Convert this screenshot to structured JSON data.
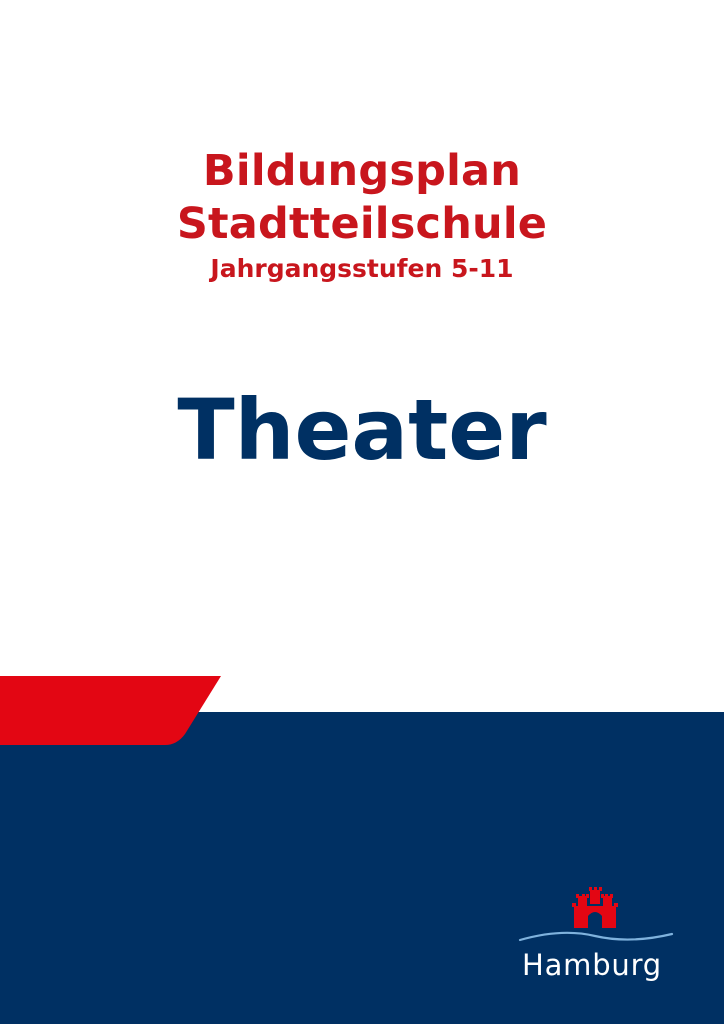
{
  "document": {
    "title_line_1": "Bildungsplan",
    "title_line_2": "Stadtteilschule",
    "subtitle": "Jahrgangsstufen 5-11",
    "subject": "Theater"
  },
  "branding": {
    "logo_text": "Hamburg",
    "logo_icon": "hamburg-castle-coat-of-arms-icon"
  },
  "colors": {
    "red": "#c8161d",
    "bright_red": "#e30613",
    "navy": "#003063",
    "water_blue": "#7fb2dd"
  }
}
